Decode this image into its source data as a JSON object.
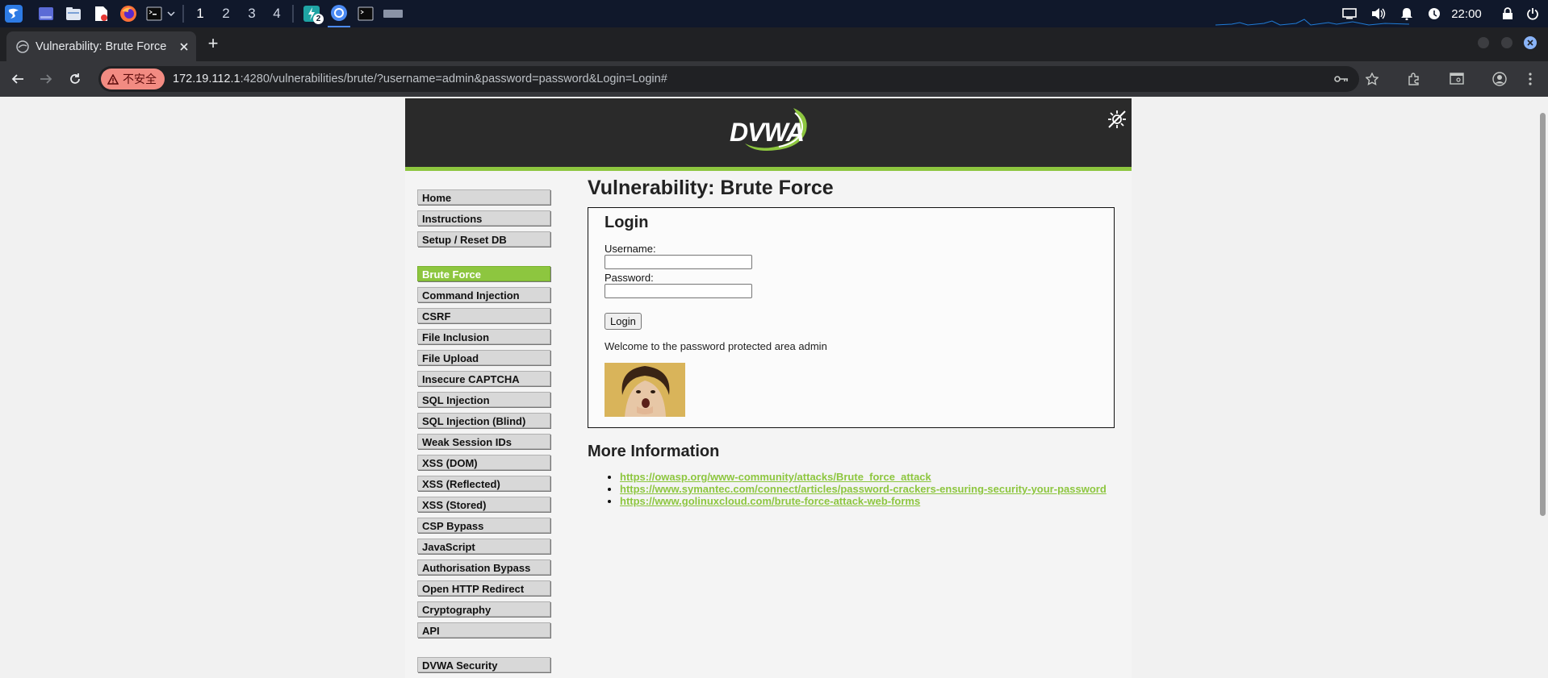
{
  "taskbar": {
    "workspaces": [
      "1",
      "2",
      "3",
      "4"
    ],
    "notification_count": "2",
    "clock": "22:00"
  },
  "browser": {
    "tab_title": "Vulnerability: Brute Force",
    "new_tab": "+",
    "insecure_label": "不安全",
    "url_host": "172.19.112.1",
    "url_rest": ":4280/vulnerabilities/brute/?username=admin&password=password&Login=Login#"
  },
  "dvwa": {
    "logo": "DVWA",
    "accent_color": "#8dc63f",
    "menu_group1": [
      "Home",
      "Instructions",
      "Setup / Reset DB"
    ],
    "menu_group2": [
      "Brute Force",
      "Command Injection",
      "CSRF",
      "File Inclusion",
      "File Upload",
      "Insecure CAPTCHA",
      "SQL Injection",
      "SQL Injection (Blind)",
      "Weak Session IDs",
      "XSS (DOM)",
      "XSS (Reflected)",
      "XSS (Stored)",
      "CSP Bypass",
      "JavaScript",
      "Authorisation Bypass",
      "Open HTTP Redirect",
      "Cryptography",
      "API"
    ],
    "menu_group3": [
      "DVWA Security"
    ],
    "selected_item": "Brute Force"
  },
  "main": {
    "title": "Vulnerability: Brute Force",
    "login": {
      "heading": "Login",
      "username_label": "Username:",
      "username_value": "",
      "password_label": "Password:",
      "password_value": "",
      "button": "Login",
      "welcome": "Welcome to the password protected area admin"
    },
    "more_info_heading": "More Information",
    "links": [
      "https://owasp.org/www-community/attacks/Brute_force_attack",
      "https://www.symantec.com/connect/articles/password-crackers-ensuring-security-your-password",
      "https://www.golinuxcloud.com/brute-force-attack-web-forms"
    ]
  }
}
